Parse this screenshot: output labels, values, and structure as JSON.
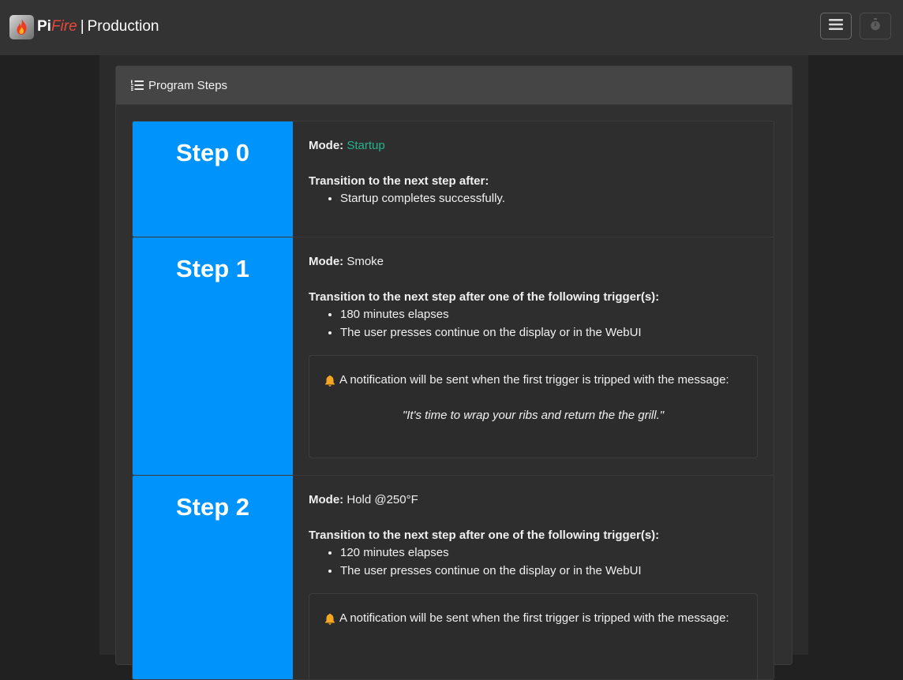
{
  "app": {
    "brand_pi": "Pi",
    "brand_fire": "Fire",
    "brand_sep": "|",
    "brand_env": "Production"
  },
  "navbar": {
    "menu_icon": "hamburger-menu-icon",
    "timer_icon": "stopwatch-icon"
  },
  "card": {
    "title": "Program Steps",
    "title_icon": "list-ol-icon"
  },
  "steps": [
    {
      "title": "Step 0",
      "mode_label": "Mode:",
      "mode_value": "Startup",
      "transition_label": "Transition to the next step after:",
      "triggers": [
        "Startup completes successfully."
      ]
    },
    {
      "title": "Step 1",
      "mode_label": "Mode:",
      "mode_value": "Smoke",
      "transition_label": "Transition to the next step after one of the following trigger(s):",
      "triggers": [
        "180 minutes elapses",
        "The user presses continue on the display or in the WebUI"
      ],
      "notification": {
        "icon": "bell-icon",
        "text": "A notification will be sent when the first trigger is tripped with the message:",
        "message": "\"It's time to wrap your ribs and return the the grill.\""
      }
    },
    {
      "title": "Step 2",
      "mode_label": "Mode:",
      "mode_value": "Hold @250°F",
      "transition_label": "Transition to the next step after one of the following trigger(s):",
      "triggers": [
        "120 minutes elapses",
        "The user presses continue on the display or in the WebUI"
      ],
      "notification": {
        "icon": "bell-icon",
        "text": "A notification will be sent when the first trigger is tripped with the message:"
      }
    }
  ],
  "colors": {
    "step_accent": "#0093fb",
    "startup_mode": "#25b48a",
    "brand_fire": "#e8483c",
    "bell": "#f5a623"
  }
}
